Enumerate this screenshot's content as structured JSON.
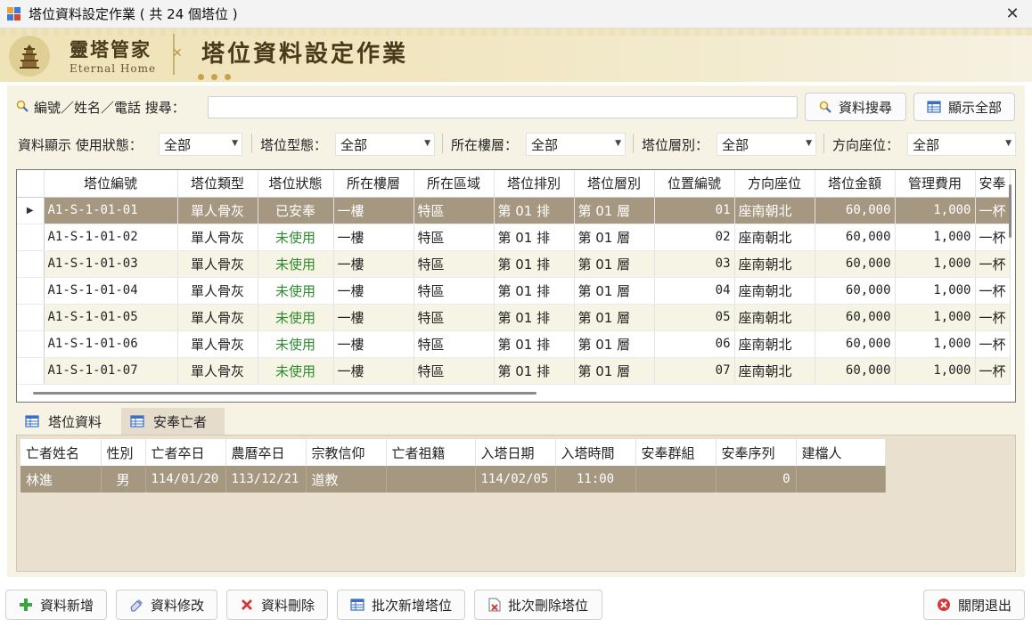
{
  "window": {
    "title": "塔位資料設定作業 ( 共 24 個塔位 )",
    "close_glyph": "✕"
  },
  "banner": {
    "brand_name": "靈塔管家",
    "brand_sub": "Eternal Home",
    "page_title": "塔位資料設定作業"
  },
  "search": {
    "label": "編號／姓名／電話 搜尋：",
    "value": "",
    "search_button": "資料搜尋",
    "show_all_button": "顯示全部"
  },
  "filters": [
    {
      "label": "資料顯示 使用狀態：",
      "value": "全部"
    },
    {
      "label": "塔位型態：",
      "value": "全部"
    },
    {
      "label": "所在樓層：",
      "value": "全部"
    },
    {
      "label": "塔位層別：",
      "value": "全部"
    },
    {
      "label": "方向座位：",
      "value": "全部"
    }
  ],
  "grid": {
    "columns": [
      "塔位編號",
      "塔位類型",
      "塔位狀態",
      "所在樓層",
      "所在區域",
      "塔位排別",
      "塔位層別",
      "位置編號",
      "方向座位",
      "塔位金額",
      "管理費用",
      "安奉"
    ],
    "row_marker": "▶",
    "rows": [
      [
        "A1-S-1-01-01",
        "單人骨灰",
        "已安奉",
        "一樓",
        "特區",
        "第 01 排",
        "第 01 層",
        "01",
        "座南朝北",
        "60,000",
        "1,000",
        "一杯"
      ],
      [
        "A1-S-1-01-02",
        "單人骨灰",
        "未使用",
        "一樓",
        "特區",
        "第 01 排",
        "第 01 層",
        "02",
        "座南朝北",
        "60,000",
        "1,000",
        "一杯"
      ],
      [
        "A1-S-1-01-03",
        "單人骨灰",
        "未使用",
        "一樓",
        "特區",
        "第 01 排",
        "第 01 層",
        "03",
        "座南朝北",
        "60,000",
        "1,000",
        "一杯"
      ],
      [
        "A1-S-1-01-04",
        "單人骨灰",
        "未使用",
        "一樓",
        "特區",
        "第 01 排",
        "第 01 層",
        "04",
        "座南朝北",
        "60,000",
        "1,000",
        "一杯"
      ],
      [
        "A1-S-1-01-05",
        "單人骨灰",
        "未使用",
        "一樓",
        "特區",
        "第 01 排",
        "第 01 層",
        "05",
        "座南朝北",
        "60,000",
        "1,000",
        "一杯"
      ],
      [
        "A1-S-1-01-06",
        "單人骨灰",
        "未使用",
        "一樓",
        "特區",
        "第 01 排",
        "第 01 層",
        "06",
        "座南朝北",
        "60,000",
        "1,000",
        "一杯"
      ],
      [
        "A1-S-1-01-07",
        "單人骨灰",
        "未使用",
        "一樓",
        "特區",
        "第 01 排",
        "第 01 層",
        "07",
        "座南朝北",
        "60,000",
        "1,000",
        "一杯"
      ]
    ]
  },
  "tabs": [
    {
      "label": "塔位資料",
      "active": true
    },
    {
      "label": "安奉亡者",
      "active": false
    }
  ],
  "deceased_grid": {
    "columns": [
      "亡者姓名",
      "性別",
      "亡者卒日",
      "農曆卒日",
      "宗教信仰",
      "亡者祖籍",
      "入塔日期",
      "入塔時間",
      "安奉群組",
      "安奉序列",
      "建檔人"
    ],
    "rows": [
      [
        "林進",
        "男",
        "114/01/20",
        "113/12/21",
        "道教",
        "",
        "114/02/05",
        "11:00",
        "",
        "0",
        ""
      ]
    ]
  },
  "buttons": {
    "add": "資料新增",
    "edit": "資料修改",
    "delete": "資料刪除",
    "batch_add": "批次新增塔位",
    "batch_delete": "批次刪除塔位",
    "exit": "關閉退出"
  },
  "colors": {
    "selected_row": "#a69781",
    "available_status": "#2d8a2d",
    "banner_gold": "#efe3b8"
  }
}
